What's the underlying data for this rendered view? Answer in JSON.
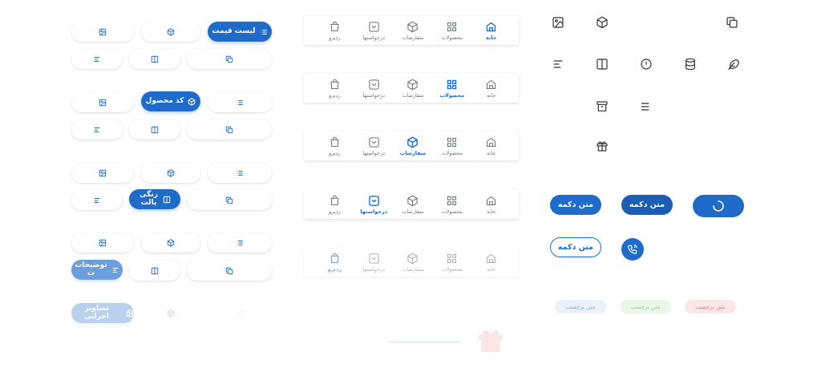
{
  "colors": {
    "primary": "#1f6bc9",
    "primary_dark": "#1a5db3",
    "text_muted": "#6f7378"
  },
  "chips": {
    "price_list": "لیست قیمت",
    "product_code": "کد محصول",
    "color_palette": "رنگی پالت",
    "descriptions": "توضیحات",
    "descriptions_tail": "ت",
    "exec_images": "تصاویر اجرایی"
  },
  "nav": {
    "items": [
      "خانه",
      "محصولات",
      "سفارشات",
      "درخواستها",
      "ردیرو"
    ],
    "active_index_per_bar": [
      0,
      1,
      2,
      3,
      4
    ]
  },
  "buttons": {
    "label": "متن دکمه",
    "loading_state": "spinner"
  },
  "badges": {
    "label": "متن برچسب",
    "colors": [
      "#e53935",
      "#43a047",
      "#1f6bc9"
    ]
  },
  "icons": [
    "image-icon",
    "cube-icon",
    "copy-icon",
    "align-icon",
    "columns-icon",
    "alert-icon",
    "database-icon",
    "feather-icon",
    "archive-icon",
    "list-icon",
    "gift-icon",
    "phone-call-icon"
  ]
}
